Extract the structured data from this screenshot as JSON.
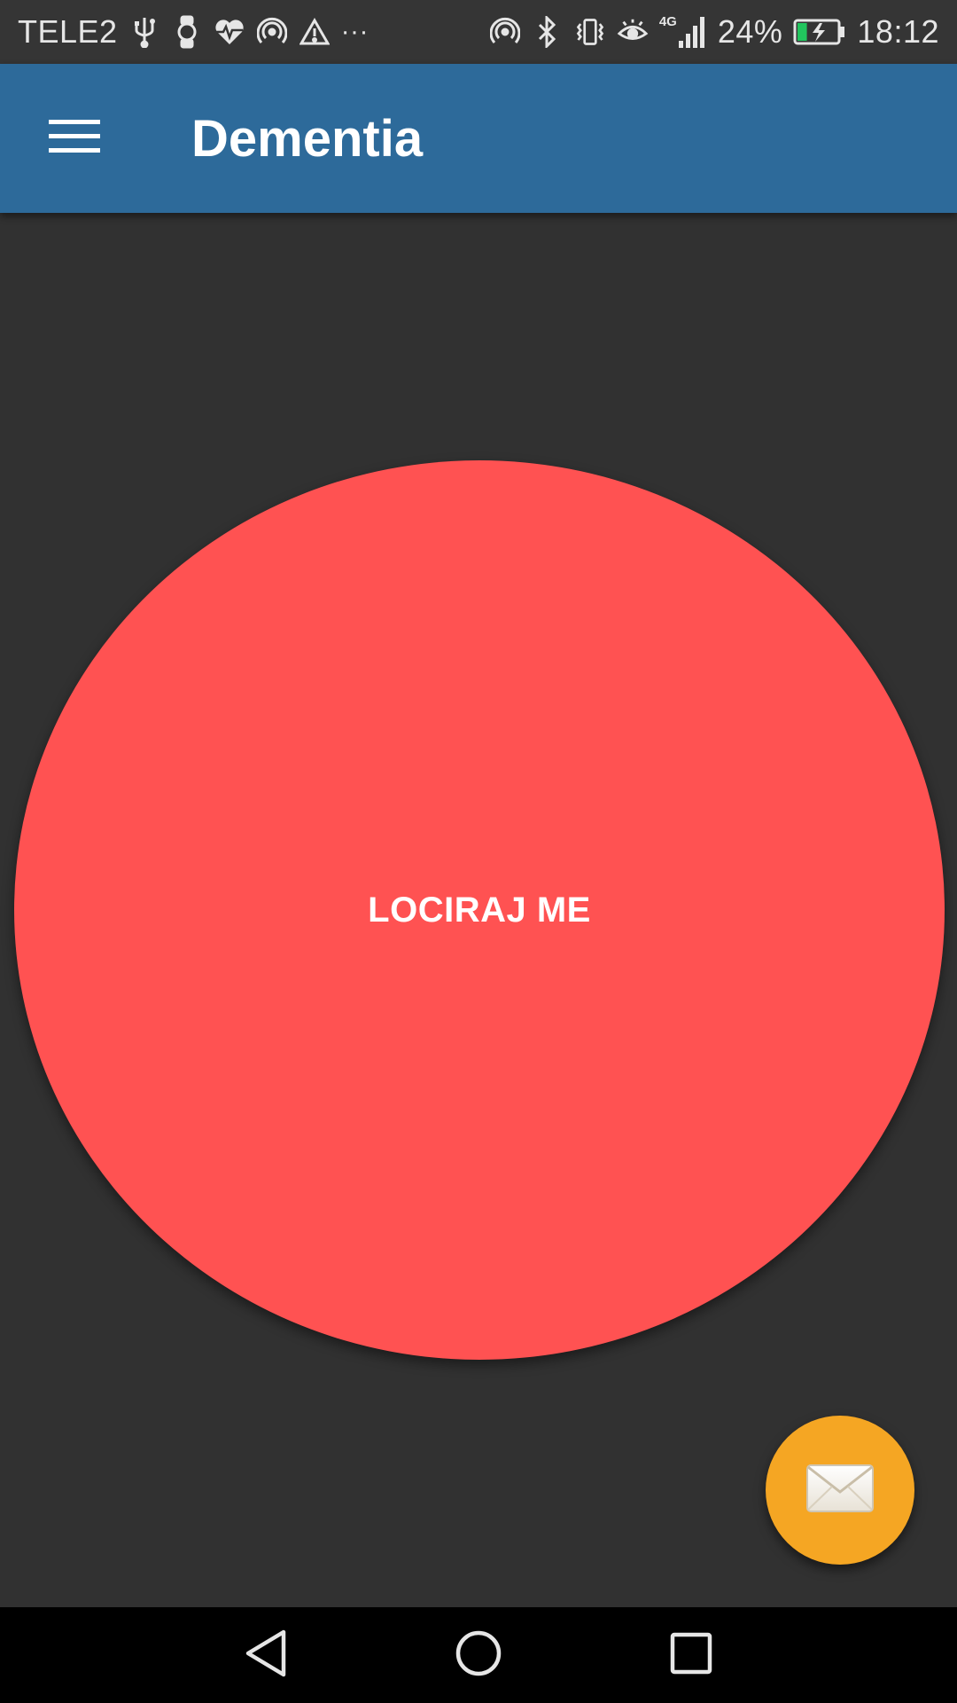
{
  "status_bar": {
    "carrier": "TELE2",
    "network": "4G",
    "battery_percent": "24%",
    "battery_level": 0.24,
    "time": "18:12",
    "more_indicator": "···",
    "left_icons": [
      "usb-icon",
      "watch-icon",
      "heart-rate-icon",
      "hotspot-icon",
      "warning-icon"
    ],
    "right_icons": [
      "hotspot-icon",
      "bluetooth-icon",
      "vibrate-icon",
      "eye-icon",
      "signal-icon",
      "battery-charging-icon"
    ]
  },
  "app_bar": {
    "title": "Dementia",
    "menu_icon": "hamburger-menu-icon",
    "background_color": "#2d6a9a"
  },
  "main": {
    "locate_button_label": "LOCIRAJ ME",
    "locate_button_color": "#ff5252",
    "fab_icon": "envelope-icon",
    "fab_color": "#f5a623"
  },
  "nav_bar": {
    "buttons": [
      "back-icon",
      "home-icon",
      "recents-icon"
    ]
  }
}
